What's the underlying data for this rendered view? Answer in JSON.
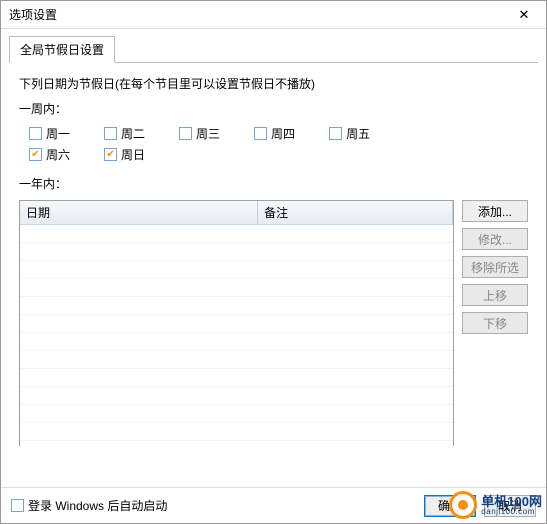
{
  "window": {
    "title": "选项设置",
    "close": "✕"
  },
  "tab": {
    "label": "全局节假日设置"
  },
  "section": {
    "holiday_note": "下列日期为节假日(在每个节目里可以设置节假日不播放)",
    "weekly_label": "一周内：",
    "yearly_label": "一年内："
  },
  "weekdays": {
    "mon": "周一",
    "tue": "周二",
    "wed": "周三",
    "thu": "周四",
    "fri": "周五",
    "sat": "周六",
    "sun": "周日"
  },
  "grid": {
    "col_date": "日期",
    "col_note": "备注"
  },
  "buttons": {
    "add": "添加...",
    "edit": "修改...",
    "remove": "移除所选",
    "up": "上移",
    "down": "下移"
  },
  "footer": {
    "autostart": "登录 Windows 后自动启动",
    "ok": "确定",
    "cancel": "取消"
  },
  "watermark": {
    "name": "单机100网",
    "domain": "danji100.com"
  }
}
